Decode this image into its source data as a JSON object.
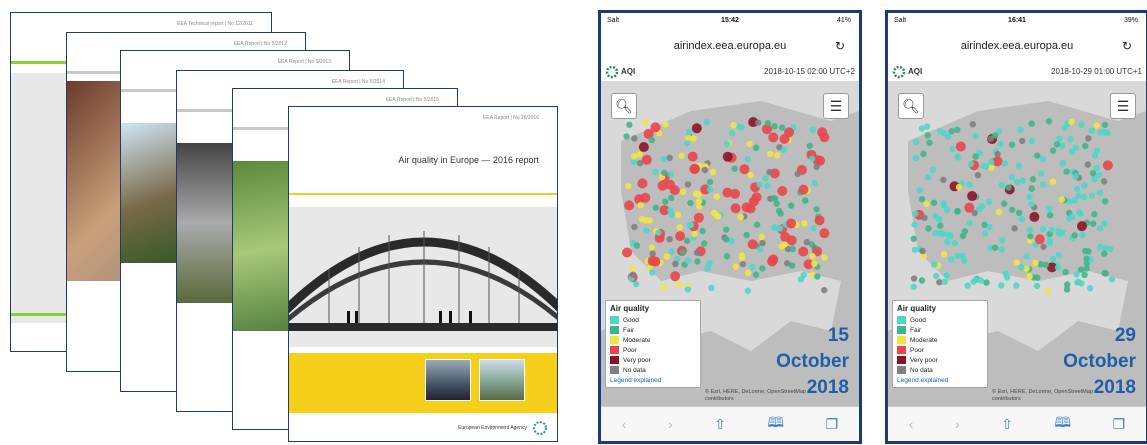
{
  "covers": [
    {
      "header": "EEA Technical report | No 12/2011"
    },
    {
      "header": "EEA Report | No 5/2012"
    },
    {
      "header": "EEA Report | No 9/2013"
    },
    {
      "header": "EEA Report | No 5/2014"
    },
    {
      "header": "EEA Report | No 5/2015"
    },
    {
      "header": "EEA Report | No 28/2016",
      "title": "Air quality in Europe — 2016 report",
      "publisher": "European Environment Agency"
    }
  ],
  "phones": [
    {
      "status": {
        "signal": "Salt",
        "time": "15:42",
        "battery": "41%"
      },
      "url": "airindex.eea.europa.eu",
      "app_label": "AQI",
      "timestamp": "2018-10-15 02:00 UTC+2",
      "date_overlay": {
        "day": "15",
        "month": "October",
        "year": "2018"
      }
    },
    {
      "status": {
        "signal": "Salt",
        "time": "16:41",
        "battery": "39%"
      },
      "url": "airindex.eea.europa.eu",
      "app_label": "AQI",
      "timestamp": "2018-10-29 01:00 UTC+1",
      "date_overlay": {
        "day": "29",
        "month": "October",
        "year": "2018"
      }
    }
  ],
  "legend": {
    "title": "Air quality",
    "items": [
      {
        "label": "Good",
        "color": "#4fd6c8"
      },
      {
        "label": "Fair",
        "color": "#41b48c"
      },
      {
        "label": "Moderate",
        "color": "#f0e641"
      },
      {
        "label": "Poor",
        "color": "#e8464b"
      },
      {
        "label": "Very poor",
        "color": "#8c1428"
      },
      {
        "label": "No data",
        "color": "#808080"
      }
    ],
    "link": "Legend explained"
  },
  "attribution": "© Esri, HERE, DeLorme, OpenStreetMap contributors",
  "colors": {
    "frame": "#1f3a73",
    "date_text": "#1f5fa8",
    "accent_yellow": "#f5cf1a"
  }
}
